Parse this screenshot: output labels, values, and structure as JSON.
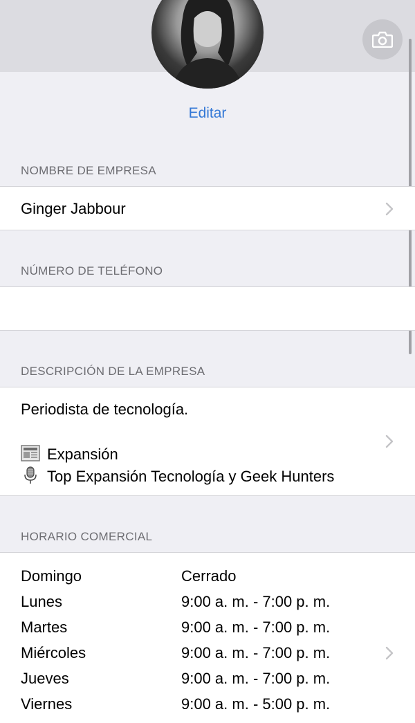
{
  "header": {
    "edit_label": "Editar",
    "avatar_icon": "profile-photo",
    "camera_icon": "camera-icon"
  },
  "business_name": {
    "header": "NOMBRE DE EMPRESA",
    "value": "Ginger Jabbour"
  },
  "phone": {
    "header": "NÚMERO DE TELÉFONO",
    "value": ""
  },
  "description": {
    "header": "DESCRIPCIÓN DE LA EMPRESA",
    "line1": "Periodista de tecnología.",
    "line2": "Expansión",
    "line2_icon": "newspaper-icon",
    "line3": "Top Expansión Tecnología y Geek Hunters",
    "line3_icon": "microphone-icon"
  },
  "hours": {
    "header": "HORARIO COMERCIAL",
    "rows": [
      {
        "day": "Domingo",
        "time": "Cerrado"
      },
      {
        "day": "Lunes",
        "time": "9:00 a. m. - 7:00 p. m."
      },
      {
        "day": "Martes",
        "time": "9:00 a. m. - 7:00 p. m."
      },
      {
        "day": "Miércoles",
        "time": "9:00 a. m. - 7:00 p. m."
      },
      {
        "day": "Jueves",
        "time": "9:00 a. m. - 7:00 p. m."
      },
      {
        "day": "Viernes",
        "time": "9:00 a. m. - 5:00 p. m."
      }
    ]
  }
}
